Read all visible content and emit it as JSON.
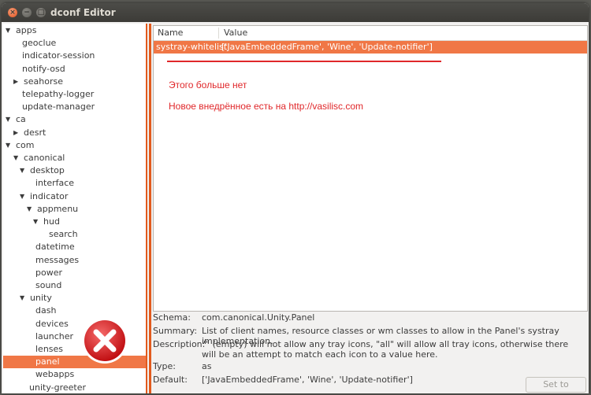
{
  "window": {
    "title": "dconf Editor",
    "close_glyph": "×",
    "minimize_glyph": "−",
    "maximize_glyph": "□"
  },
  "tree": {
    "expander_open_icon": "triangle-down-icon",
    "expander_closed_icon": "triangle-right-icon",
    "items": [
      {
        "label": "apps",
        "expander": "open"
      },
      {
        "label": "geoclue"
      },
      {
        "label": "indicator-session"
      },
      {
        "label": "notify-osd"
      },
      {
        "label": "seahorse",
        "expander": "closed"
      },
      {
        "label": "telepathy-logger"
      },
      {
        "label": "update-manager"
      },
      {
        "label": "ca",
        "expander": "open"
      },
      {
        "label": "desrt",
        "expander": "closed"
      },
      {
        "label": "com",
        "expander": "open"
      },
      {
        "label": "canonical",
        "expander": "open"
      },
      {
        "label": "desktop",
        "expander": "open"
      },
      {
        "label": "interface"
      },
      {
        "label": "indicator",
        "expander": "open"
      },
      {
        "label": "appmenu",
        "expander": "open"
      },
      {
        "label": "hud",
        "expander": "open"
      },
      {
        "label": "search"
      },
      {
        "label": "datetime"
      },
      {
        "label": "messages"
      },
      {
        "label": "power"
      },
      {
        "label": "sound"
      },
      {
        "label": "unity",
        "expander": "open"
      },
      {
        "label": "dash"
      },
      {
        "label": "devices"
      },
      {
        "label": "launcher"
      },
      {
        "label": "lenses"
      },
      {
        "label": "panel",
        "selected": true
      },
      {
        "label": "webapps"
      },
      {
        "label": "unity-greeter"
      }
    ]
  },
  "keys_table": {
    "columns": [
      "Name",
      "Value"
    ],
    "rows": [
      {
        "name": "systray-whitelist",
        "value": "['JavaEmbeddedFrame', 'Wine', 'Update-notifier']",
        "selected": true
      }
    ]
  },
  "annotation": {
    "line1": "Этого больше нет",
    "line2": "Новое внедрённое есть на http://vasilisc.com",
    "color": "#e0272a"
  },
  "details": {
    "schema_label": "Schema:",
    "schema_value": "com.canonical.Unity.Panel",
    "summary_label": "Summary:",
    "summary_value": "List of client names, resource classes or wm classes to allow in the Panel's systray implementation.",
    "description_label": "Description:",
    "description_value": "\"\" (empty) will not allow any tray icons, \"all\" will allow all tray icons, otherwise there will be an attempt to match each icon to a value here.",
    "type_label": "Type:",
    "type_value": "as",
    "default_label": "Default:",
    "default_value": "['JavaEmbeddedFrame', 'Wine', 'Update-notifier']",
    "set_default_label": "Set to Default"
  },
  "colors": {
    "accent": "#f07746",
    "splitter": "#e25a1c",
    "error_badge": "#e0272a"
  }
}
